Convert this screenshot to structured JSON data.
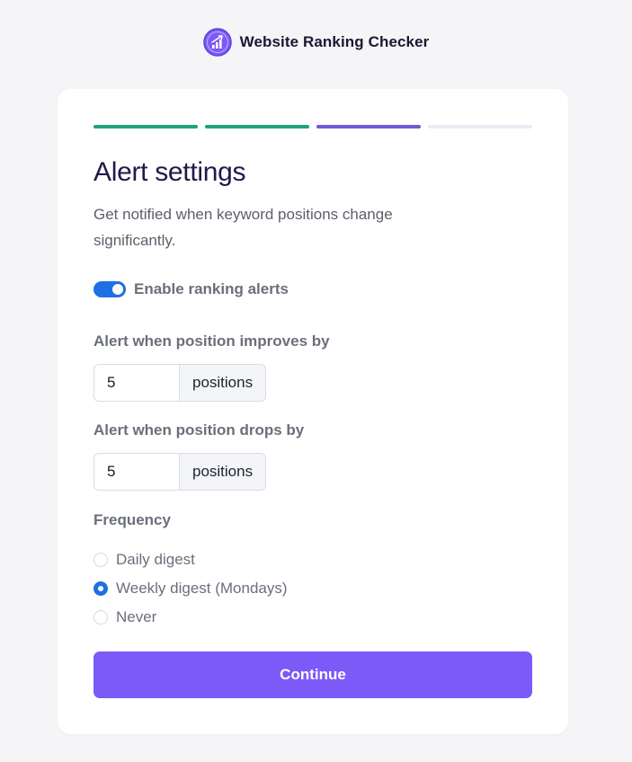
{
  "brand": {
    "name": "Website Ranking Checker",
    "logo_icon": "bar-chart-trend-icon",
    "logo_color": "#7b5af7"
  },
  "stepper": {
    "steps": [
      {
        "state": "done"
      },
      {
        "state": "done"
      },
      {
        "state": "current"
      },
      {
        "state": "upcoming"
      }
    ],
    "colors": {
      "done": "#1aa57f",
      "current": "#6b5bd6",
      "upcoming": "#ecebf3"
    }
  },
  "page": {
    "title": "Alert settings",
    "subtitle": "Get notified when keyword positions change significantly."
  },
  "alerts_toggle": {
    "label": "Enable ranking alerts",
    "enabled": true,
    "color": "#1f6fe5"
  },
  "improves": {
    "label": "Alert when position improves by",
    "value": "5",
    "unit": "positions"
  },
  "drops": {
    "label": "Alert when position drops by",
    "value": "5",
    "unit": "positions"
  },
  "frequency": {
    "label": "Frequency",
    "options": [
      {
        "label": "Daily digest",
        "selected": false
      },
      {
        "label": "Weekly digest (Mondays)",
        "selected": true
      },
      {
        "label": "Never",
        "selected": false
      }
    ]
  },
  "actions": {
    "continue_label": "Continue",
    "continue_color": "#7b5af7"
  }
}
